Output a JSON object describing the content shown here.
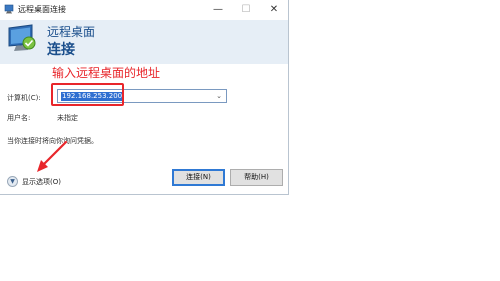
{
  "window": {
    "title": "远程桌面连接",
    "controls": {
      "minimize": "—",
      "maximize": "☐",
      "close": "✕"
    }
  },
  "header": {
    "line1": "远程桌面",
    "line2": "连接"
  },
  "annotation": {
    "text": "输入远程桌面的地址",
    "color": "#e8262b"
  },
  "form": {
    "computer_label": "计算机(C):",
    "computer_value": "192.168.253.200",
    "username_label": "用户名:",
    "username_value": "未指定",
    "info_text": "当你连接时将向你询问凭据。"
  },
  "options": {
    "label": "显示选项(O)",
    "icon": "chevron-down-icon"
  },
  "buttons": {
    "connect": "连接(N)",
    "help": "帮助(H)"
  },
  "colors": {
    "header_bg": "#e6eef6",
    "header_text": "#1b4f8c",
    "selection": "#2f6fd1",
    "accent": "#2f79d4"
  }
}
